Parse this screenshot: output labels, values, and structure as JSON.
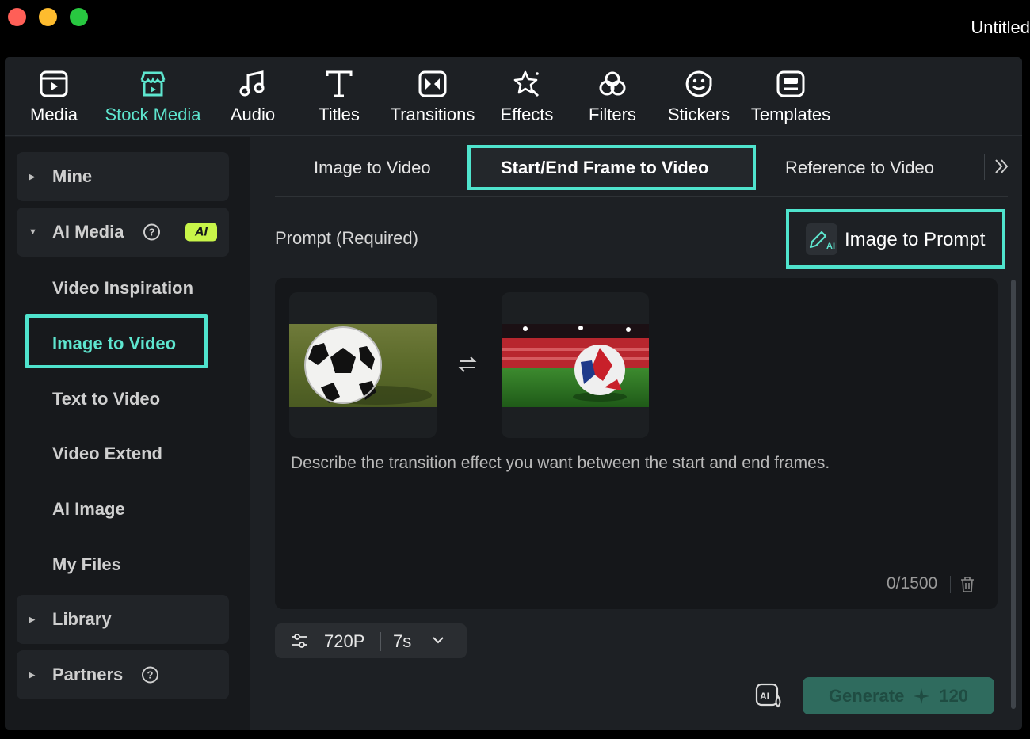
{
  "window": {
    "title": "Untitled"
  },
  "toolbar": {
    "items": [
      {
        "label": "Media",
        "icon": "media-icon"
      },
      {
        "label": "Stock Media",
        "icon": "stock-media-icon",
        "active": true
      },
      {
        "label": "Audio",
        "icon": "music-note-icon"
      },
      {
        "label": "Titles",
        "icon": "text-t-icon"
      },
      {
        "label": "Transitions",
        "icon": "transitions-icon"
      },
      {
        "label": "Effects",
        "icon": "effects-star-icon"
      },
      {
        "label": "Filters",
        "icon": "filters-icon"
      },
      {
        "label": "Stickers",
        "icon": "sticker-face-icon"
      },
      {
        "label": "Templates",
        "icon": "templates-icon"
      }
    ]
  },
  "sidebar": {
    "mine": "Mine",
    "ai_media": "AI Media",
    "ai_badge": "AI",
    "items": [
      "Video Inspiration",
      "Image to Video",
      "Text to Video",
      "Video Extend",
      "AI Image",
      "My Files"
    ],
    "active_item": "Image to Video",
    "library": "Library",
    "partners": "Partners",
    "help_glyph": "?"
  },
  "main": {
    "tabs": [
      "Image to Video",
      "Start/End Frame to Video",
      "Reference to Video"
    ],
    "active_tab": "Start/End Frame to Video",
    "prompt_label": "Prompt (Required)",
    "image_to_prompt": "Image to Prompt",
    "prompt_placeholder": "Describe the transition effect you want between the start and end frames.",
    "counter": "0/1500",
    "resolution": "720P",
    "duration": "7s",
    "generate_label": "Generate",
    "generate_cost": "120"
  },
  "colors": {
    "accent": "#5ee6cf",
    "highlight": "#4fe3cd",
    "ai_badge": "#c8f549",
    "generate_bg": "#2f6b5e"
  }
}
